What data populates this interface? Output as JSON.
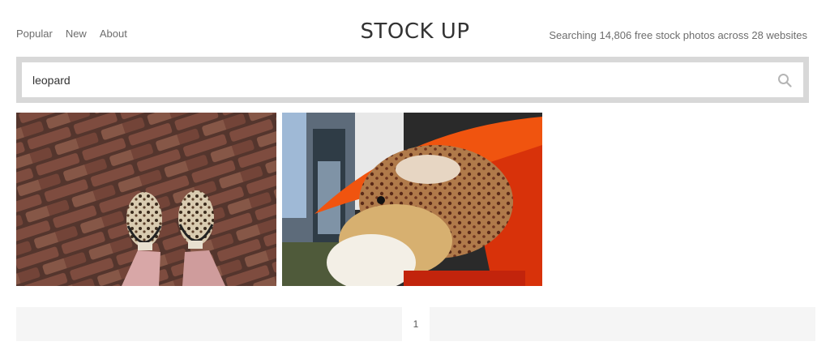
{
  "nav": {
    "items": [
      "Popular",
      "New",
      "About"
    ]
  },
  "header": {
    "logo": "STOCK UP",
    "tagline": "Searching 14,806 free stock photos across 28 websites"
  },
  "search": {
    "value": "leopard",
    "icon": "search-icon"
  },
  "results": [
    {
      "subject": "leopard-print shoes on brick pavement",
      "icon": "photo"
    },
    {
      "subject": "leopard-print stuffed toy under orange umbrella",
      "icon": "photo"
    }
  ],
  "pagination": {
    "current_page": "1"
  },
  "colors": {
    "search_border": "#d8d8d8",
    "pager_bg": "#f5f5f5",
    "text": "#6d6d6d",
    "logo": "#333333"
  }
}
